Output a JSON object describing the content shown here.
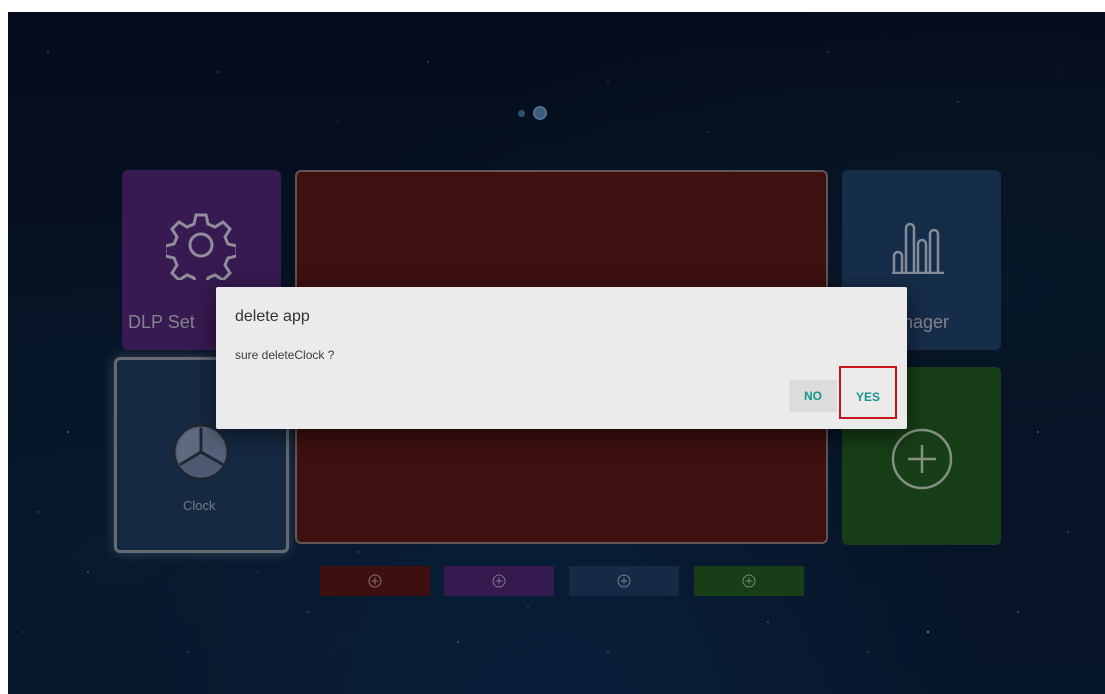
{
  "home": {
    "tiles": {
      "dlp_settings_label": "DLP Set",
      "manager_label": "Manager",
      "clock_label": "Clock"
    },
    "icons": {
      "gear": "gear-icon",
      "bars": "bar-chart-icon",
      "clock": "clock-icon",
      "add": "plus-circle-icon"
    }
  },
  "dialog": {
    "title": "delete app",
    "message": "sure deleteClock ?",
    "no_label": "NO",
    "yes_label": "YES"
  },
  "colors": {
    "dialog_button_text": "#14978a",
    "highlight_border": "#c4161c",
    "tile_purple": "#4b2471",
    "tile_red": "#561717",
    "tile_blue": "#1f3f66",
    "tile_green": "#20561f"
  }
}
